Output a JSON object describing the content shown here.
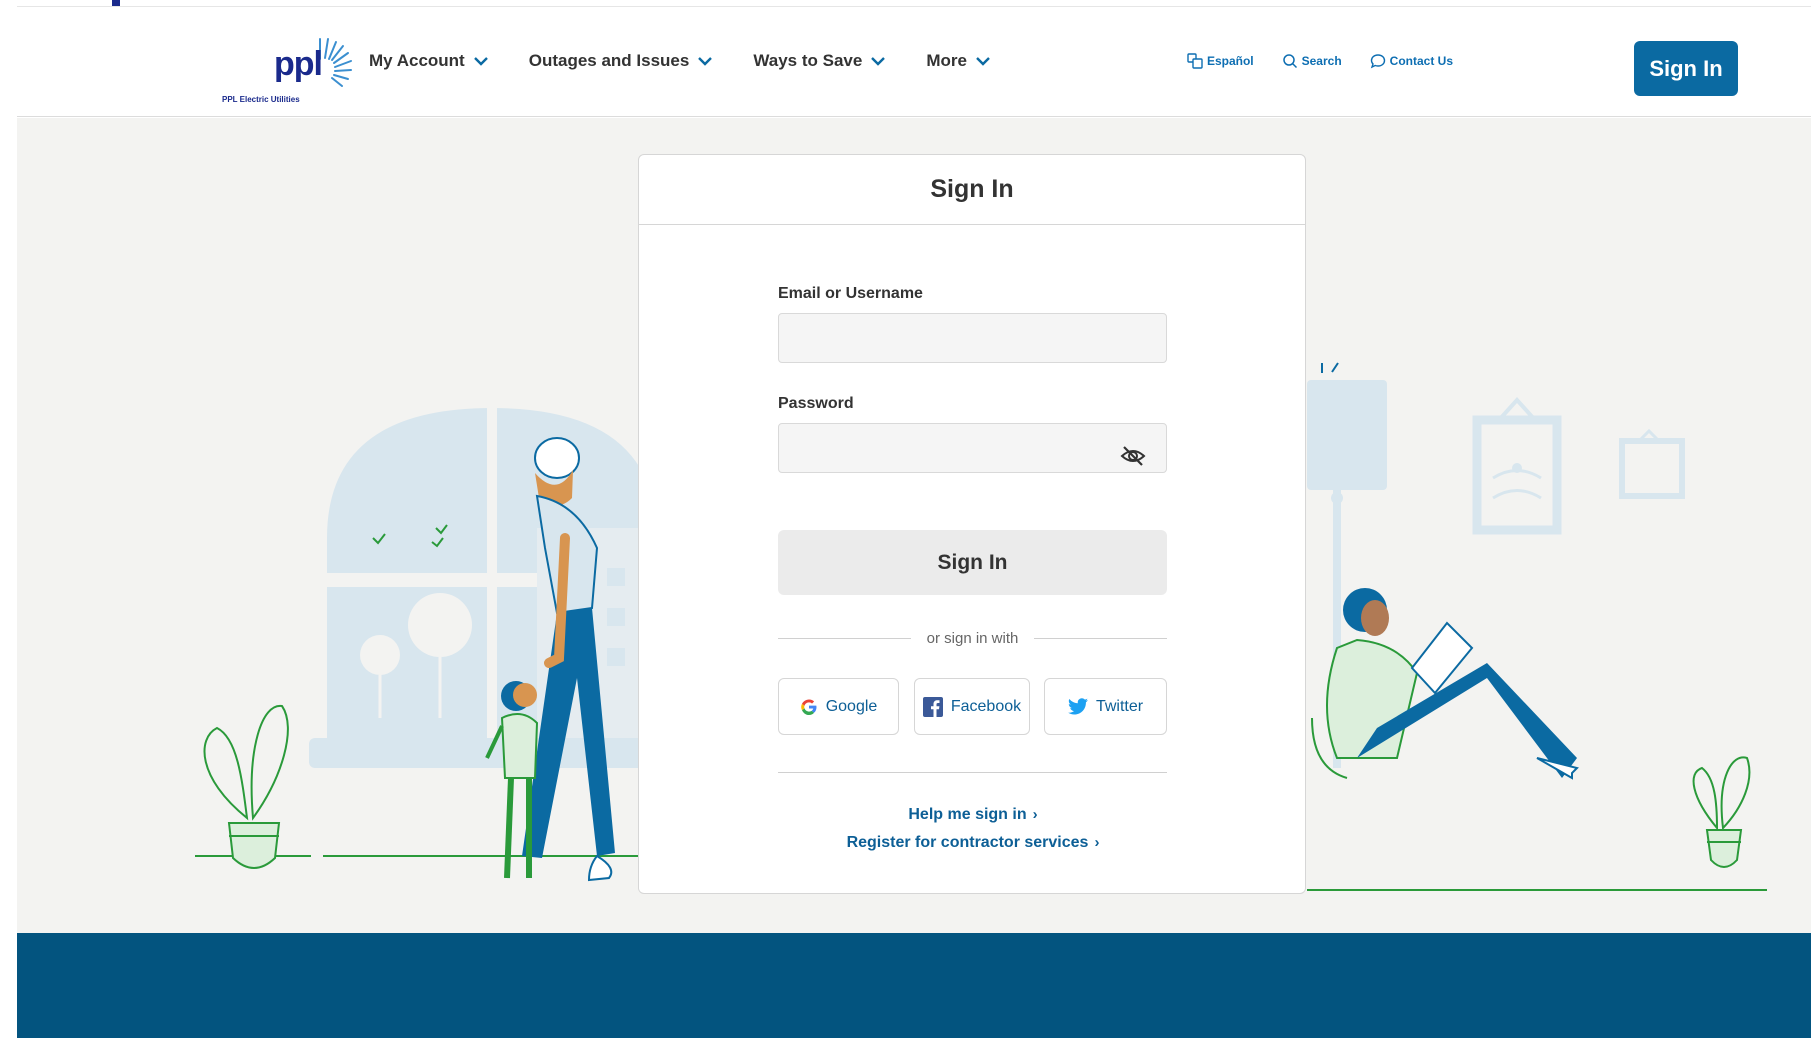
{
  "brand": {
    "logo_text": "ppl",
    "logo_subtitle": "PPL Electric Utilities",
    "accent": "#0b6aa2",
    "logo_color": "#1a2a8c",
    "footer_color": "#03547f"
  },
  "nav": {
    "items": [
      {
        "label": "My Account"
      },
      {
        "label": "Outages and Issues"
      },
      {
        "label": "Ways to Save"
      },
      {
        "label": "More"
      }
    ]
  },
  "utility": {
    "espanol": "Español",
    "search": "Search",
    "contact": "Contact Us",
    "sign_in": "Sign In"
  },
  "signin_card": {
    "title": "Sign In",
    "email_label": "Email or Username",
    "email_value": "",
    "password_label": "Password",
    "password_value": "",
    "submit_label": "Sign In",
    "divider_text": "or sign in with",
    "social": [
      {
        "label": "Google",
        "icon": "google-icon"
      },
      {
        "label": "Facebook",
        "icon": "facebook-icon"
      },
      {
        "label": "Twitter",
        "icon": "twitter-icon"
      }
    ],
    "help_link": "Help me sign in",
    "register_link": "Register for contractor services"
  }
}
